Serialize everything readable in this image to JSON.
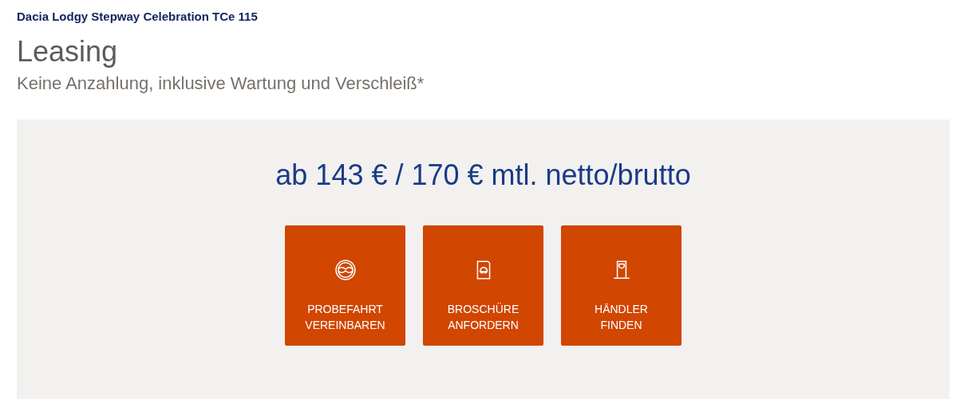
{
  "model": "Dacia Lodgy Stepway Celebration TCe 115",
  "heading": "Leasing",
  "subheading": "Keine Anzahlung, inklusive Wartung und Verschleiß*",
  "price": "ab 143 € / 170 € mtl. netto/brutto",
  "actions": [
    {
      "kind": "wheel",
      "label": "PROBEFAHRT VEREINBAREN"
    },
    {
      "kind": "brochure",
      "label": "BROSCHÜRE ANFORDERN"
    },
    {
      "kind": "dealer",
      "label": "HÄNDLER FINDEN"
    }
  ]
}
